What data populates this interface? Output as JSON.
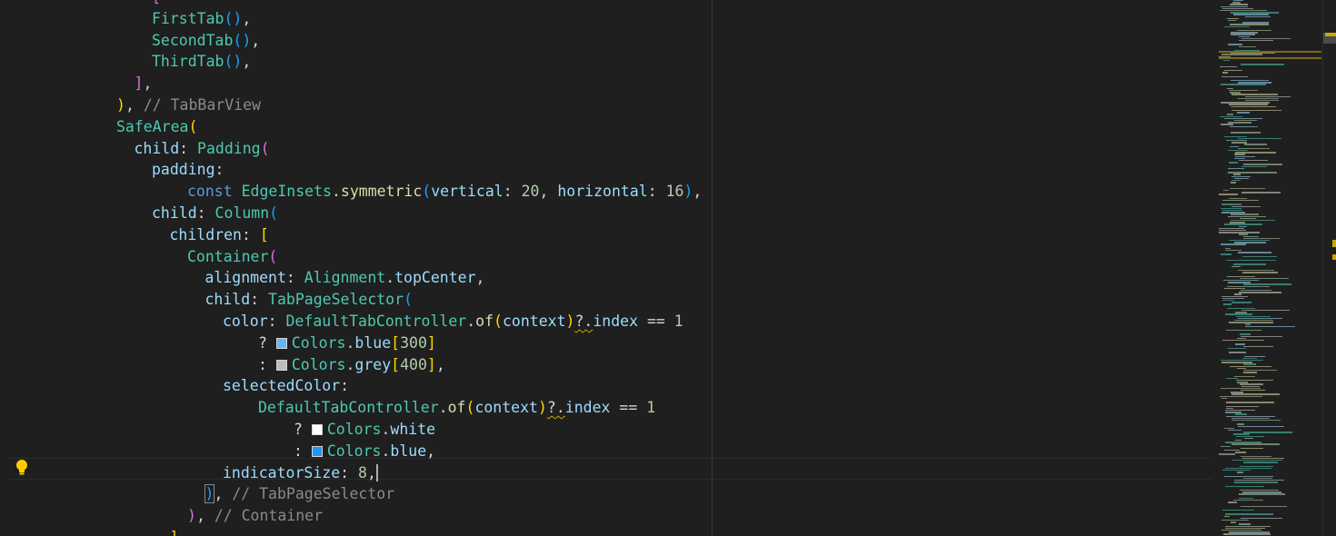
{
  "editor": {
    "lines": [
      {
        "indent": 16,
        "tokens": [
          {
            "t": "[",
            "c": "p2"
          }
        ]
      },
      {
        "indent": 16,
        "tokens": [
          {
            "t": "FirstTab",
            "c": "cls"
          },
          {
            "t": "()",
            "c": "p3"
          },
          {
            "t": ",",
            "c": "pl"
          }
        ]
      },
      {
        "indent": 16,
        "tokens": [
          {
            "t": "SecondTab",
            "c": "cls"
          },
          {
            "t": "()",
            "c": "p3"
          },
          {
            "t": ",",
            "c": "pl"
          }
        ]
      },
      {
        "indent": 16,
        "tokens": [
          {
            "t": "ThirdTab",
            "c": "cls"
          },
          {
            "t": "()",
            "c": "p3"
          },
          {
            "t": ",",
            "c": "pl"
          }
        ]
      },
      {
        "indent": 14,
        "tokens": [
          {
            "t": "]",
            "c": "p2"
          },
          {
            "t": ",",
            "c": "pl"
          }
        ]
      },
      {
        "indent": 12,
        "tokens": [
          {
            "t": ")",
            "c": "p1"
          },
          {
            "t": ", ",
            "c": "pl"
          },
          {
            "t": "// TabBarView",
            "c": "cm"
          }
        ]
      },
      {
        "indent": 12,
        "tokens": [
          {
            "t": "SafeArea",
            "c": "cls"
          },
          {
            "t": "(",
            "c": "p1"
          }
        ]
      },
      {
        "indent": 14,
        "tokens": [
          {
            "t": "child",
            "c": "prop"
          },
          {
            "t": ": ",
            "c": "pl"
          },
          {
            "t": "Padding",
            "c": "cls"
          },
          {
            "t": "(",
            "c": "p2"
          }
        ]
      },
      {
        "indent": 16,
        "tokens": [
          {
            "t": "padding",
            "c": "prop"
          },
          {
            "t": ":",
            "c": "pl"
          }
        ]
      },
      {
        "indent": 20,
        "tokens": [
          {
            "t": "const ",
            "c": "kw"
          },
          {
            "t": "EdgeInsets",
            "c": "cls"
          },
          {
            "t": ".",
            "c": "pl"
          },
          {
            "t": "symmetric",
            "c": "fn"
          },
          {
            "t": "(",
            "c": "p3"
          },
          {
            "t": "vertical",
            "c": "prop"
          },
          {
            "t": ": ",
            "c": "pl"
          },
          {
            "t": "20",
            "c": "num"
          },
          {
            "t": ", ",
            "c": "pl"
          },
          {
            "t": "horizontal",
            "c": "prop"
          },
          {
            "t": ": ",
            "c": "pl"
          },
          {
            "t": "16",
            "c": "num"
          },
          {
            "t": ")",
            "c": "p3"
          },
          {
            "t": ",",
            "c": "pl"
          }
        ]
      },
      {
        "indent": 16,
        "tokens": [
          {
            "t": "child",
            "c": "prop"
          },
          {
            "t": ": ",
            "c": "pl"
          },
          {
            "t": "Column",
            "c": "cls"
          },
          {
            "t": "(",
            "c": "p3"
          }
        ]
      },
      {
        "indent": 18,
        "tokens": [
          {
            "t": "children",
            "c": "prop"
          },
          {
            "t": ": ",
            "c": "pl"
          },
          {
            "t": "[",
            "c": "p1"
          }
        ]
      },
      {
        "indent": 20,
        "tokens": [
          {
            "t": "Container",
            "c": "cls"
          },
          {
            "t": "(",
            "c": "p2"
          }
        ]
      },
      {
        "indent": 22,
        "tokens": [
          {
            "t": "alignment",
            "c": "prop"
          },
          {
            "t": ": ",
            "c": "pl"
          },
          {
            "t": "Alignment",
            "c": "cls"
          },
          {
            "t": ".",
            "c": "pl"
          },
          {
            "t": "topCenter",
            "c": "prop"
          },
          {
            "t": ",",
            "c": "pl"
          }
        ]
      },
      {
        "indent": 22,
        "tokens": [
          {
            "t": "child",
            "c": "prop"
          },
          {
            "t": ": ",
            "c": "pl"
          },
          {
            "t": "TabPageSelector",
            "c": "cls"
          },
          {
            "t": "(",
            "c": "p3"
          }
        ]
      },
      {
        "indent": 24,
        "tokens": [
          {
            "t": "color",
            "c": "prop"
          },
          {
            "t": ": ",
            "c": "pl"
          },
          {
            "t": "DefaultTabController",
            "c": "cls"
          },
          {
            "t": ".",
            "c": "pl"
          },
          {
            "t": "of",
            "c": "fn"
          },
          {
            "t": "(",
            "c": "p1"
          },
          {
            "t": "context",
            "c": "prop"
          },
          {
            "t": ")",
            "c": "p1"
          },
          {
            "t": "?.",
            "c": "pl",
            "sq": true
          },
          {
            "t": "index",
            "c": "prop"
          },
          {
            "t": " == ",
            "c": "pl"
          },
          {
            "t": "1",
            "c": "num"
          }
        ]
      },
      {
        "indent": 28,
        "tokens": [
          {
            "t": "? ",
            "c": "pl"
          },
          {
            "sw": "#64b5f6"
          },
          {
            "t": "Colors",
            "c": "cls"
          },
          {
            "t": ".",
            "c": "pl"
          },
          {
            "t": "blue",
            "c": "prop"
          },
          {
            "t": "[",
            "c": "p1"
          },
          {
            "t": "300",
            "c": "num"
          },
          {
            "t": "]",
            "c": "p1"
          }
        ]
      },
      {
        "indent": 28,
        "tokens": [
          {
            "t": ": ",
            "c": "pl"
          },
          {
            "sw": "#bdbdbd"
          },
          {
            "t": "Colors",
            "c": "cls"
          },
          {
            "t": ".",
            "c": "pl"
          },
          {
            "t": "grey",
            "c": "prop"
          },
          {
            "t": "[",
            "c": "p1"
          },
          {
            "t": "400",
            "c": "num"
          },
          {
            "t": "]",
            "c": "p1"
          },
          {
            "t": ",",
            "c": "pl"
          }
        ]
      },
      {
        "indent": 24,
        "tokens": [
          {
            "t": "selectedColor",
            "c": "prop"
          },
          {
            "t": ":",
            "c": "pl"
          }
        ]
      },
      {
        "indent": 28,
        "tokens": [
          {
            "t": "DefaultTabController",
            "c": "cls"
          },
          {
            "t": ".",
            "c": "pl"
          },
          {
            "t": "of",
            "c": "fn"
          },
          {
            "t": "(",
            "c": "p1"
          },
          {
            "t": "context",
            "c": "prop"
          },
          {
            "t": ")",
            "c": "p1"
          },
          {
            "t": "?.",
            "c": "pl",
            "sq": true
          },
          {
            "t": "index",
            "c": "prop"
          },
          {
            "t": " == ",
            "c": "pl"
          },
          {
            "t": "1",
            "c": "num"
          }
        ]
      },
      {
        "indent": 32,
        "tokens": [
          {
            "t": "? ",
            "c": "pl"
          },
          {
            "sw": "#ffffff"
          },
          {
            "t": "Colors",
            "c": "cls"
          },
          {
            "t": ".",
            "c": "pl"
          },
          {
            "t": "white",
            "c": "prop"
          }
        ]
      },
      {
        "indent": 32,
        "tokens": [
          {
            "t": ": ",
            "c": "pl"
          },
          {
            "sw": "#2196f3"
          },
          {
            "t": "Colors",
            "c": "cls"
          },
          {
            "t": ".",
            "c": "pl"
          },
          {
            "t": "blue",
            "c": "prop"
          },
          {
            "t": ",",
            "c": "pl"
          }
        ]
      },
      {
        "indent": 24,
        "tokens": [
          {
            "t": "indicatorSize",
            "c": "prop"
          },
          {
            "t": ": ",
            "c": "pl"
          },
          {
            "t": "8",
            "c": "num"
          },
          {
            "t": ",",
            "c": "pl"
          },
          {
            "caret": true
          }
        ]
      },
      {
        "indent": 22,
        "tokens": [
          {
            "t": ")",
            "c": "p3",
            "box": true
          },
          {
            "t": ", ",
            "c": "pl"
          },
          {
            "t": "// TabPageSelector",
            "c": "cm"
          }
        ]
      },
      {
        "indent": 20,
        "tokens": [
          {
            "t": ")",
            "c": "p2"
          },
          {
            "t": ", ",
            "c": "pl"
          },
          {
            "t": "// Container",
            "c": "cm"
          }
        ]
      },
      {
        "indent": 18,
        "tokens": [
          {
            "t": "]",
            "c": "p1"
          },
          {
            "t": ",",
            "c": "pl"
          }
        ]
      }
    ],
    "lightbulb_icon": "lightbulb-icon",
    "colors": {
      "background": "#1f1f1f",
      "class": "#4ec9b0",
      "property": "#9cdcfe",
      "function": "#dcdcaa",
      "number": "#b5cea8",
      "keyword": "#569cd6",
      "comment": "#8b8b8b",
      "bracket_gold": "#ffd700",
      "bracket_orchid": "#da70d6",
      "bracket_blue": "#179fff"
    }
  }
}
